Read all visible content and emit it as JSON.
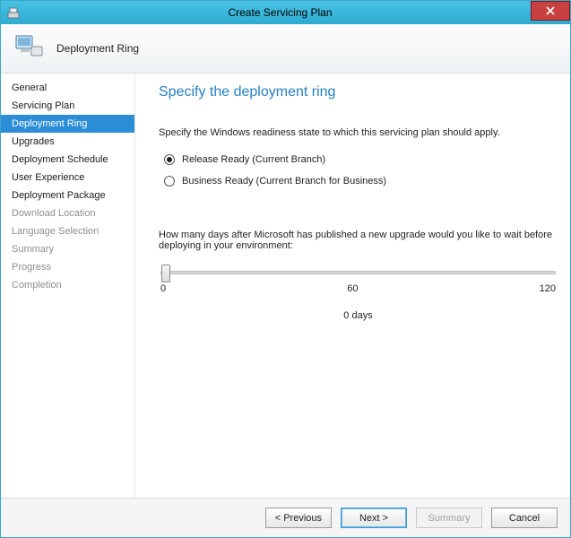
{
  "window": {
    "title": "Create Servicing Plan"
  },
  "header": {
    "label": "Deployment Ring"
  },
  "sidebar": {
    "items": [
      {
        "label": "General",
        "state": "normal"
      },
      {
        "label": "Servicing Plan",
        "state": "normal"
      },
      {
        "label": "Deployment Ring",
        "state": "selected"
      },
      {
        "label": "Upgrades",
        "state": "normal"
      },
      {
        "label": "Deployment Schedule",
        "state": "normal"
      },
      {
        "label": "User Experience",
        "state": "normal"
      },
      {
        "label": "Deployment Package",
        "state": "normal"
      },
      {
        "label": "Download Location",
        "state": "disabled"
      },
      {
        "label": "Language Selection",
        "state": "disabled"
      },
      {
        "label": "Summary",
        "state": "disabled"
      },
      {
        "label": "Progress",
        "state": "disabled"
      },
      {
        "label": "Completion",
        "state": "disabled"
      }
    ]
  },
  "main": {
    "heading": "Specify the deployment ring",
    "instruction": "Specify the Windows readiness state to which this servicing plan should apply.",
    "radio_release": "Release Ready (Current Branch)",
    "radio_business": "Business Ready (Current Branch for Business)",
    "days_question": "How many days after Microsoft has published a new upgrade would you like to wait before deploying in your environment:",
    "slider": {
      "min_label": "0",
      "mid_label": "60",
      "max_label": "120",
      "value_label": "0 days",
      "value": 0,
      "max": 120
    }
  },
  "footer": {
    "prev": "< Previous",
    "next": "Next >",
    "summary": "Summary",
    "cancel": "Cancel"
  }
}
